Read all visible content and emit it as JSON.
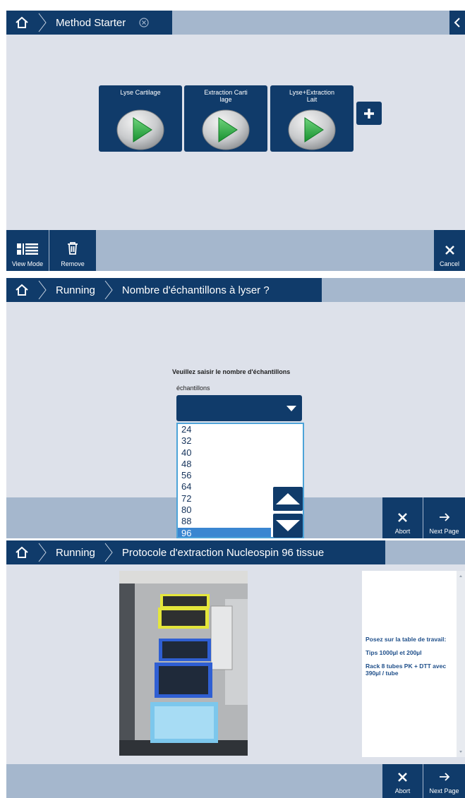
{
  "screen1": {
    "breadcrumb": [
      "Method Starter"
    ],
    "methods": [
      {
        "label": "Lyse Cartilage"
      },
      {
        "label": "Extraction Cartilage",
        "label_lines": [
          "Extraction Carti",
          "lage"
        ]
      },
      {
        "label": "Lyse+Extraction Lait",
        "label_lines": [
          "Lyse+Extraction",
          "Lait"
        ]
      }
    ],
    "footer": {
      "view_mode": "View Mode",
      "remove": "Remove",
      "cancel": "Cancel"
    }
  },
  "screen2": {
    "breadcrumb": [
      "Running",
      "Nombre d'échantillons à lyser ?"
    ],
    "prompt": "Veuillez saisir le nombre d'échantillons",
    "field_label": "échantillons",
    "options": [
      "24",
      "32",
      "40",
      "48",
      "56",
      "64",
      "72",
      "80",
      "88",
      "96"
    ],
    "selected": "96",
    "footer": {
      "abort": "Abort",
      "next": "Next Page"
    }
  },
  "screen3": {
    "breadcrumb": [
      "Running",
      "Protocole d'extraction Nucleospin 96 tissue"
    ],
    "instructions": {
      "heading": "Posez sur la table de travail:",
      "item1": "Tips 1000µl et 200µl",
      "item2": "Rack 8 tubes PK + DTT avec 390µl / tube"
    },
    "footer": {
      "abort": "Abort",
      "next": "Next Page"
    }
  },
  "colors": {
    "navy": "#103b6a",
    "bar": "#a5b7cd",
    "background": "#dde1ea",
    "play": "#2fa84a",
    "selection": "#3a86d1"
  }
}
